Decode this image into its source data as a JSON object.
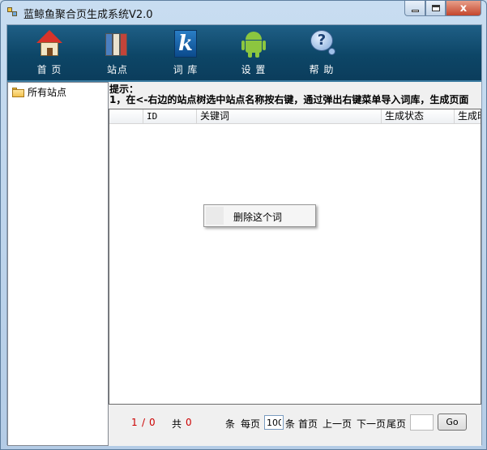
{
  "window": {
    "title": "蓝鲸鱼聚合页生成系统V2.0",
    "close_label": "x",
    "icons": {
      "app": "app-icon",
      "minimize": "minimize-icon",
      "maximize": "maximize-icon"
    }
  },
  "toolbar": {
    "items": [
      {
        "label": "首 页",
        "icon": "home-icon"
      },
      {
        "label": "站点",
        "icon": "books-icon"
      },
      {
        "label": "词 库",
        "icon": "k-dictionary-icon",
        "glyph": "k"
      },
      {
        "label": "设 置",
        "icon": "android-icon"
      },
      {
        "label": "帮 助",
        "icon": "help-icon",
        "glyph": "?"
      }
    ]
  },
  "tree": {
    "root": {
      "label": "所有站点",
      "icon": "folder-icon"
    }
  },
  "tips": {
    "title": "提示：",
    "line1": "1，在<-右边的站点树选中站点名称按右键，通过弹出右键菜单导入词库，生成页面"
  },
  "grid": {
    "columns": [
      "",
      "ID",
      "关键词",
      "生成状态",
      "生成时间"
    ]
  },
  "context_menu": {
    "items": [
      {
        "label": "删除这个词"
      }
    ]
  },
  "pager": {
    "current_page": "1",
    "separator": "/",
    "total_pages": "0",
    "total_label": "共",
    "total_count": "0",
    "unit": "条",
    "per_page_label": "每页",
    "per_page_value": "100",
    "per_page_unit": "条",
    "first": "首页",
    "prev": "上一页",
    "next": "下一页",
    "last": "尾页",
    "page_input_value": "",
    "go_label": "Go"
  },
  "colors": {
    "toolbar_bg": "#0d4667",
    "page_number": "#cc0000",
    "android_green": "#8cc63f",
    "home_roof": "#d8332a"
  }
}
